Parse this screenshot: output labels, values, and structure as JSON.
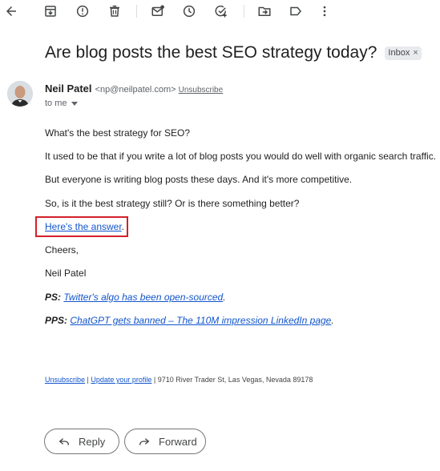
{
  "toolbar": {
    "icons": [
      "back-arrow-icon",
      "archive-icon",
      "report-spam-icon",
      "delete-icon",
      "mark-unread-icon",
      "snooze-icon",
      "add-task-icon",
      "move-to-icon",
      "label-icon",
      "more-vert-icon"
    ]
  },
  "email": {
    "subject": "Are blog posts the best SEO strategy today?",
    "label": "Inbox",
    "label_remove": "×",
    "sender_name": "Neil Patel",
    "sender_email": "<np@neilpatel.com>",
    "unsubscribe_top": "Unsubscribe",
    "to": "to me",
    "body": {
      "line1": "What's the best strategy for SEO?",
      "line2": "It used to be that if you write a lot of blog posts you would do well with organic search traffic.",
      "line3": "But everyone is writing blog posts these days. And it's more competitive.",
      "line4": "So, is it the best strategy still? Or is there something better?",
      "answer_link": "Here's the answer",
      "answer_period": ".",
      "cheers": "Cheers,",
      "signature": "Neil Patel",
      "ps_label": "PS:",
      "ps_link": "Twitter's algo has been open-sourced",
      "ps_period": ".",
      "pps_label": "PPS:",
      "pps_link": "ChatGPT gets banned – The 110M impression LinkedIn page",
      "pps_period": "."
    },
    "footer": {
      "unsubscribe": "Unsubscribe",
      "sep1": " | ",
      "update_profile": "Update your profile",
      "sep2": " | ",
      "address": "9710 River Trader St, Las Vegas, Nevada 89178"
    }
  },
  "actions": {
    "reply": "Reply",
    "forward": "Forward"
  },
  "colors": {
    "link": "#1155cc",
    "highlight": "#d3202a"
  }
}
